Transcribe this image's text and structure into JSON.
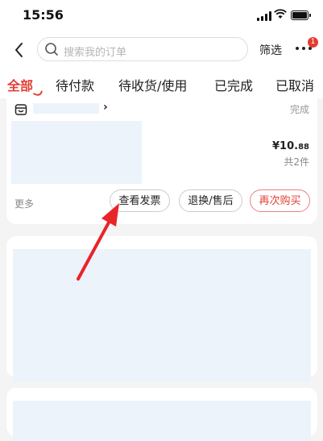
{
  "status_bar": {
    "time": "15:56"
  },
  "search": {
    "placeholder": "搜索我的订单"
  },
  "header": {
    "filter_label": "筛选",
    "badge_count": "1"
  },
  "tabs": [
    {
      "label": "全部",
      "active": true
    },
    {
      "label": "待付款"
    },
    {
      "label": "待收货/使用"
    },
    {
      "label": "已完成"
    },
    {
      "label": "已取消"
    }
  ],
  "order": {
    "status": "完成",
    "price_main": "¥10.",
    "price_cents": "88",
    "quantity": "共2件",
    "more_label": "更多",
    "buttons": {
      "invoice": "查看发票",
      "refund": "退换/售后",
      "rebuy": "再次购买"
    }
  },
  "colors": {
    "accent": "#e43d32",
    "placeholder_block": "#edf3fa",
    "background": "#f4f4f4"
  },
  "icons": [
    "back-icon",
    "search-icon",
    "more-icon",
    "shop-icon",
    "chevron-right-icon",
    "annotation-arrow-icon"
  ]
}
